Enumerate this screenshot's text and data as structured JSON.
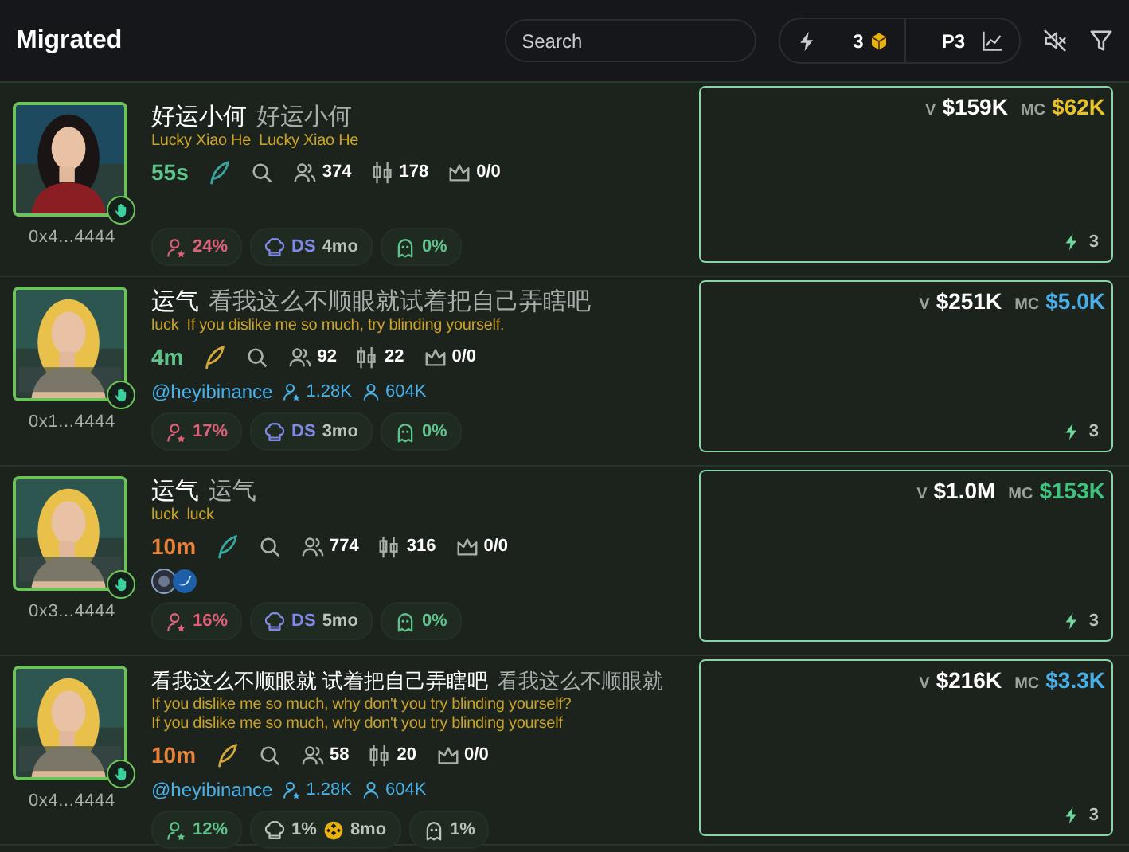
{
  "header": {
    "title": "Migrated",
    "search": {
      "placeholder": "Search"
    },
    "quick_buy": "3",
    "preset": "P3"
  },
  "rows": [
    {
      "address": "0x4...4444",
      "title": "好运小何",
      "title_alt": "好运小何",
      "subtitle": "Lucky Xiao He",
      "subtitle_alt": "Lucky Xiao He",
      "age": {
        "text": "55s",
        "color": "#5fc48c"
      },
      "feather": {
        "color": "#3aa6a0"
      },
      "holders": "374",
      "trades": "178",
      "crown": "0/0",
      "socials": [],
      "twitter": null,
      "pills": [
        {
          "kind": "holders",
          "value": "24%",
          "color": "#e0607a"
        },
        {
          "kind": "dev",
          "label": "DS",
          "coin": false,
          "age": "4mo",
          "color": "#8088e8"
        },
        {
          "kind": "ghost",
          "value": "0%",
          "color": "#5fc48c"
        }
      ],
      "card": {
        "v_label": "V",
        "volume": "$159K",
        "mc_label": "MC",
        "mc": {
          "text": "$62K",
          "color": "#e8c22a"
        },
        "boosts": "3"
      }
    },
    {
      "address": "0x1...4444",
      "title": "运气",
      "title_alt": "看我这么不顺眼就试着把自己弄瞎吧",
      "subtitle": "luck",
      "subtitle_alt": "If you dislike me so much, try blinding yourself.",
      "age": {
        "text": "4m",
        "color": "#5fc48c"
      },
      "feather": {
        "color": "#d4a93a"
      },
      "holders": "92",
      "trades": "22",
      "crown": "0/0",
      "socials": [],
      "twitter": {
        "handle": "@heyibinance",
        "followers": "1.28K",
        "following": "604K"
      },
      "pills": [
        {
          "kind": "holders",
          "value": "17%",
          "color": "#e0607a"
        },
        {
          "kind": "dev",
          "label": "DS",
          "coin": false,
          "age": "3mo",
          "color": "#8088e8"
        },
        {
          "kind": "ghost",
          "value": "0%",
          "color": "#5fc48c"
        }
      ],
      "card": {
        "v_label": "V",
        "volume": "$251K",
        "mc_label": "MC",
        "mc": {
          "text": "$5.0K",
          "color": "#4aaee8"
        },
        "boosts": "3"
      }
    },
    {
      "address": "0x3...4444",
      "title": "运气",
      "title_alt": "运气",
      "subtitle": "luck",
      "subtitle_alt": "luck",
      "age": {
        "text": "10m",
        "color": "#e8823a"
      },
      "feather": {
        "color": "#3aa6a0"
      },
      "holders": "774",
      "trades": "316",
      "crown": "0/0",
      "socials": [
        {
          "kind": "orb"
        },
        {
          "kind": "bird"
        }
      ],
      "twitter": null,
      "pills": [
        {
          "kind": "holders",
          "value": "16%",
          "color": "#e0607a"
        },
        {
          "kind": "dev",
          "label": "DS",
          "coin": false,
          "age": "5mo",
          "color": "#8088e8"
        },
        {
          "kind": "ghost",
          "value": "0%",
          "color": "#5fc48c"
        }
      ],
      "card": {
        "v_label": "V",
        "volume": "$1.0M",
        "mc_label": "MC",
        "mc": {
          "text": "$153K",
          "color": "#3ec47e"
        },
        "boosts": "3"
      }
    },
    {
      "address": "0x4...4444",
      "title": "看我这么不顺眼就 试着把自己弄瞎吧",
      "title_alt": "看我这么不顺眼就",
      "subtitle": "If you dislike me so much, why don't you try blinding yourself?",
      "subtitle_alt": "If you dislike me so much, why don't you try blinding yourself",
      "age": {
        "text": "10m",
        "color": "#e8823a"
      },
      "feather": {
        "color": "#d4a93a"
      },
      "holders": "58",
      "trades": "20",
      "crown": "0/0",
      "socials": [],
      "twitter": {
        "handle": "@heyibinance",
        "followers": "1.28K",
        "following": "604K"
      },
      "pills": [
        {
          "kind": "holders",
          "value": "12%",
          "color": "#5fc48c"
        },
        {
          "kind": "dev",
          "label": "1%",
          "coin": true,
          "age": "8mo",
          "color": "#b8c4b8"
        },
        {
          "kind": "ghost",
          "value": "1%",
          "color": "#b8c4b8"
        }
      ],
      "card": {
        "v_label": "V",
        "volume": "$216K",
        "mc_label": "MC",
        "mc": {
          "text": "$3.3K",
          "color": "#4aaee8"
        },
        "boosts": "3"
      }
    }
  ]
}
